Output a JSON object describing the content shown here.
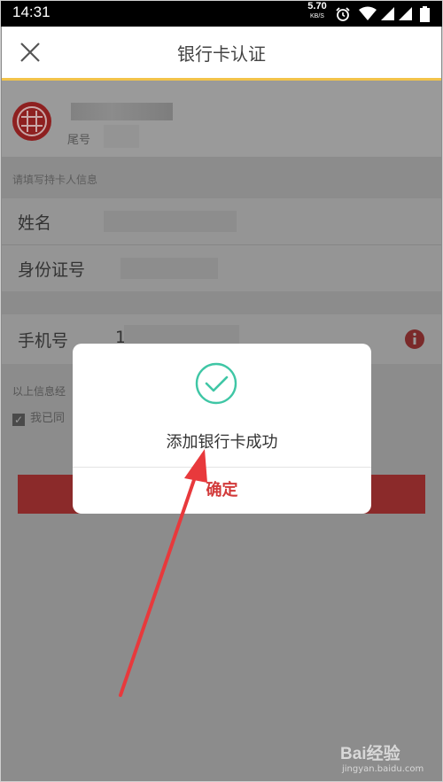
{
  "status_bar": {
    "time": "14:31",
    "speed_value": "5.70",
    "speed_unit": "KB/S",
    "icons": [
      "alarm-icon",
      "wifi-icon",
      "signal-icon",
      "signal-icon",
      "battery-icon"
    ]
  },
  "titlebar": {
    "title": "银行卡认证",
    "close_icon": "close-icon"
  },
  "bank_card": {
    "tail_label": "尾号"
  },
  "form": {
    "section_hint": "请填写持卡人信息",
    "name_label": "姓名",
    "id_label": "身份证号",
    "phone_label": "手机号",
    "phone_value_prefix": "1"
  },
  "footer": {
    "confirm_note": "以上信息经",
    "agree_text": "我已同"
  },
  "dialog": {
    "message": "添加银行卡成功",
    "ok_label": "确定"
  },
  "watermark": {
    "logo": "Bai经验",
    "url": "jingyan.baidu.com"
  },
  "colors": {
    "accent_line": "#f2c34a",
    "ok_text": "#d23a3a",
    "check": "#3fc6a5",
    "arrow": "#e8393c"
  }
}
